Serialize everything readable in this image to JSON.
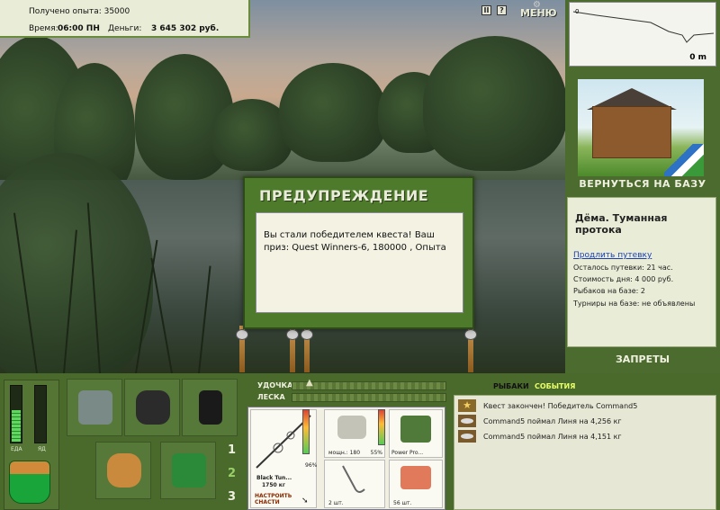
{
  "info": {
    "experience": "Получено опыта: 35000",
    "time_label": "Время:",
    "time_value": "06:00 ПН",
    "money_label": "Деньги:",
    "money_value": "3 645 302 руб."
  },
  "controls": {
    "pause": "II",
    "help": "?",
    "menu": "МЕНЮ"
  },
  "depth": {
    "start_marker": "0",
    "readout": "0 m"
  },
  "right": {
    "return_button": "ВЕРНУТЬСЯ НА БАЗУ",
    "location_name": "Дёма. Туманная протока",
    "extend_link": "Продлить путевку",
    "line1": "Осталось путевки: 21 час.",
    "line2": "Стоимость дня: 4 000 руб.",
    "line3": "Рыбаков на базе: 2",
    "line4": "Турниры на базе: не объявлены",
    "bans_button": "ЗАПРЕТЫ"
  },
  "dialog": {
    "title": "ПРЕДУПРЕЖДЕНИЕ",
    "message": "Вы стали победителем квеста! Ваш приз: Quest Winners-6, 180000 , Опыта"
  },
  "meters": {
    "food_label": "ЕДА",
    "poison_label": "ЯД",
    "food_level": 0.55,
    "poison_level": 0.0
  },
  "slots": {
    "n1": "1",
    "n2": "2",
    "n3": "3"
  },
  "sliders": {
    "rod_label": "УДОЧКА",
    "line_label": "ЛЕСКА"
  },
  "tackle": {
    "rod_name": "Black Tun...",
    "rod_weight": "1750 кг",
    "rod_percent": "96%",
    "reel_power": "мощн.: 180",
    "reel_percent": "55%",
    "line_name": "Power Pro...",
    "hook_count": "2 шт.",
    "bait_count": "56 шт.",
    "setup_button": "НАСТРОИТЬ СНАСТИ"
  },
  "events": {
    "tab_fishers": "РЫБАКИ",
    "tab_events": "СОБЫТИЯ",
    "items": [
      "Квест закончен! Победитель Command5",
      "Command5 поймал Линя на 4,256 кг",
      "Command5 поймал Линя на 4,151 кг"
    ]
  },
  "colors": {
    "panel_green": "#4a6a2c",
    "panel_light": "#e9ecd6",
    "link_blue": "#1a3fb4"
  }
}
